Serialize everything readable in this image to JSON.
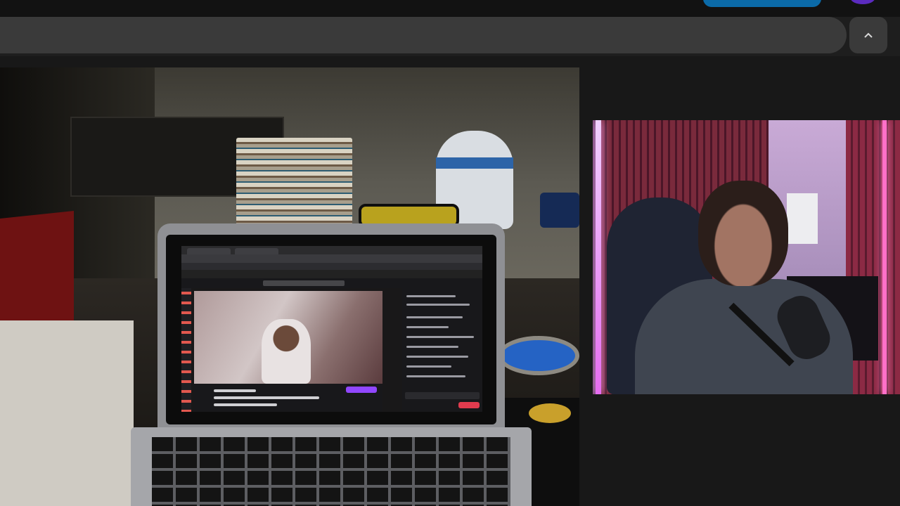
{
  "icons": {
    "collapse": "chevron-up-icon"
  },
  "colors": {
    "page_background": "#181818",
    "toolbar_background": "#1e1e1e",
    "searchbar_background": "#3a3a3a",
    "accent_blue": "#0b6aa8",
    "avatar_purple": "#5b2bbf",
    "twitch_purple": "#9147ff"
  },
  "media": {
    "main_video": "desk-scene-with-laptop-showing-twitch-stream",
    "webcam_feed": "streamer-webcam-with-microphone"
  }
}
